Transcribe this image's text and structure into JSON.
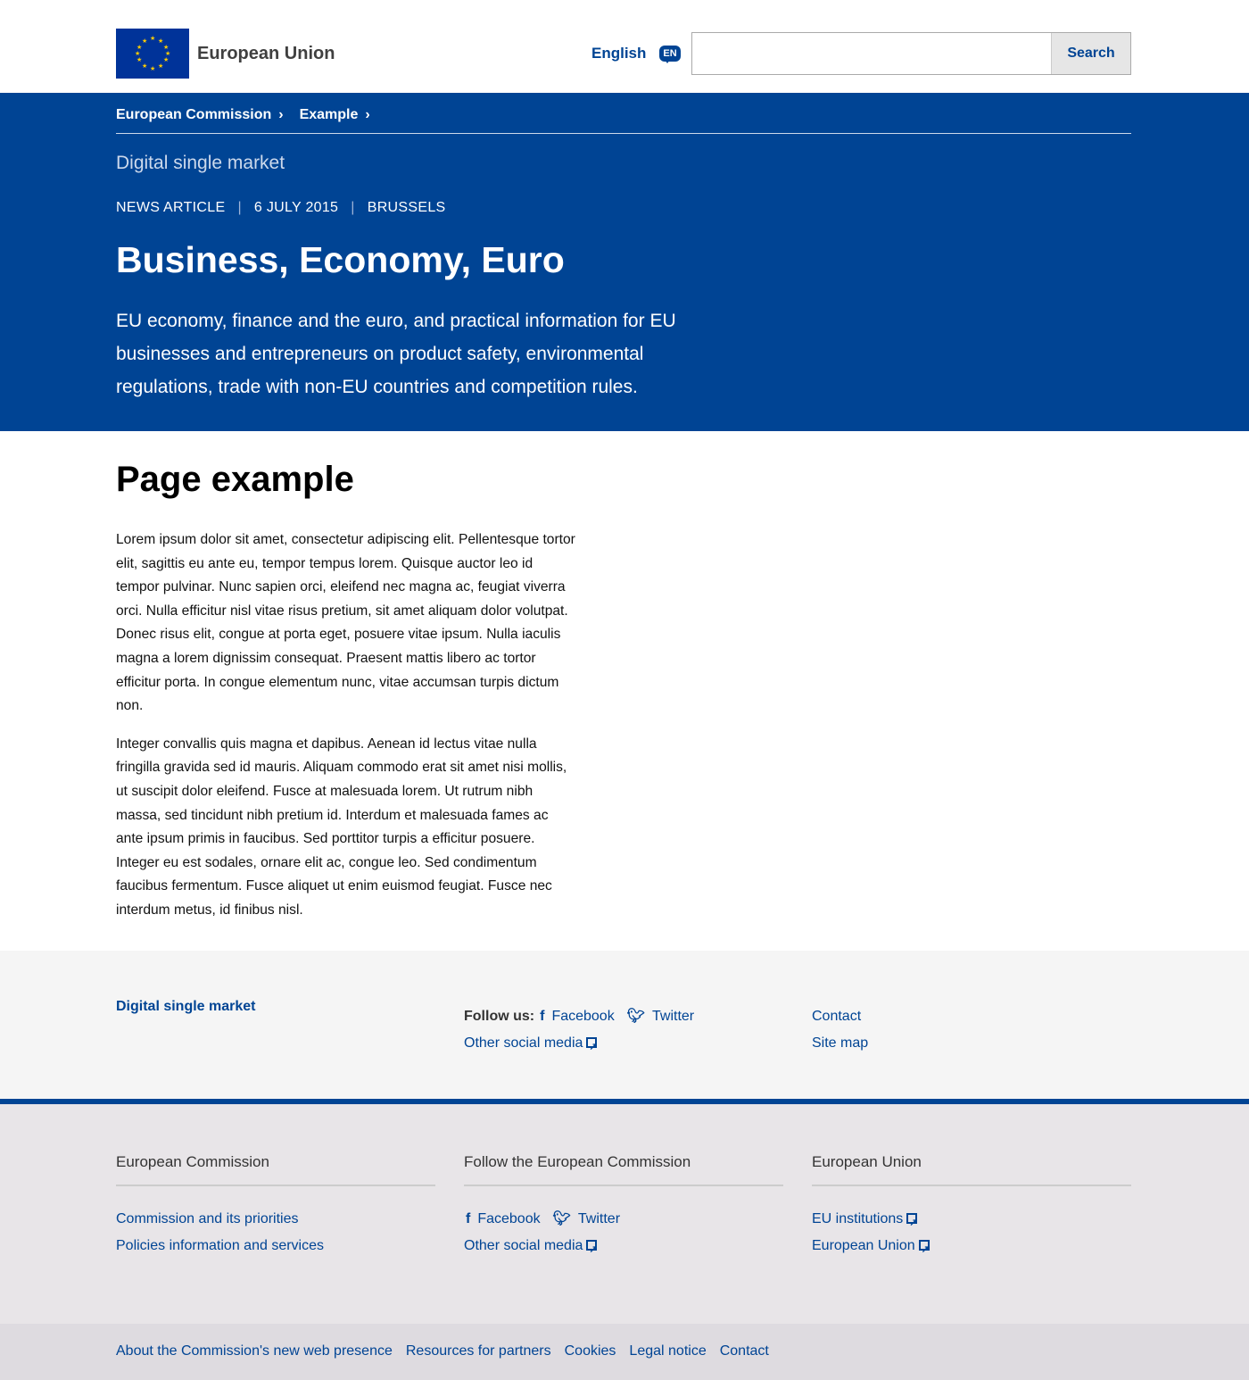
{
  "header": {
    "site_name": "European Union",
    "language": "English",
    "language_code": "EN",
    "search_placeholder": "",
    "search_label": "Search"
  },
  "breadcrumb": [
    "European Commission",
    "Example"
  ],
  "hero": {
    "site": "Digital single market",
    "meta": [
      "NEWS ARTICLE",
      "6 JULY 2015",
      "BRUSSELS"
    ],
    "title": "Business, Economy, Euro",
    "lead": "EU economy, finance and the euro, and practical information for EU businesses and entrepreneurs on product safety, environmental regulations, trade with non-EU countries and competition rules."
  },
  "main": {
    "title": "Page example",
    "paragraphs": [
      "Lorem ipsum dolor sit amet, consectetur adipiscing elit. Pellentesque tortor elit, sagittis eu ante eu, tempor tempus lorem. Quisque auctor leo id tempor pulvinar. Nunc sapien orci, eleifend nec magna ac, feugiat viverra orci. Nulla efficitur nisl vitae risus pretium, sit amet aliquam dolor volutpat. Donec risus elit, congue at porta eget, posuere vitae ipsum. Nulla iaculis magna a lorem dignissim consequat. Praesent mattis libero ac tortor efficitur porta. In congue elementum nunc, vitae accumsan turpis dictum non.",
      "Integer convallis quis magna et dapibus. Aenean id lectus vitae nulla fringilla gravida sed id mauris. Aliquam commodo erat sit amet nisi mollis, ut suscipit dolor eleifend. Fusce at malesuada lorem. Ut rutrum nibh massa, sed tincidunt nibh pretium id. Interdum et malesuada fames ac ante ipsum primis in faucibus. Sed porttitor turpis a efficitur posuere. Integer eu est sodales, ornare elit ac, congue leo. Sed condimentum faucibus fermentum. Fusce aliquet ut enim euismod feugiat. Fusce nec interdum metus, id finibus nisl."
    ]
  },
  "site_footer": {
    "site": "Digital single market",
    "follow": "Follow us:",
    "facebook": "Facebook",
    "twitter": "Twitter",
    "other_social": "Other social media",
    "contact": "Contact",
    "sitemap": "Site map"
  },
  "corporate_footer": {
    "col1": {
      "title": "European Commission",
      "links": [
        "Commission and its priorities",
        "Policies information and services"
      ]
    },
    "col2": {
      "title": "Follow the European Commission",
      "facebook": "Facebook",
      "twitter": "Twitter",
      "other_social": "Other social media"
    },
    "col3": {
      "title": "European Union",
      "links": [
        "EU institutions",
        "European Union"
      ]
    }
  },
  "bottom_links": [
    "About the Commission's new web presence",
    "Resources for partners",
    "Cookies",
    "Legal notice",
    "Contact"
  ],
  "colors": {
    "primary": "#004494",
    "footer_bg": "#e8e5e8"
  }
}
